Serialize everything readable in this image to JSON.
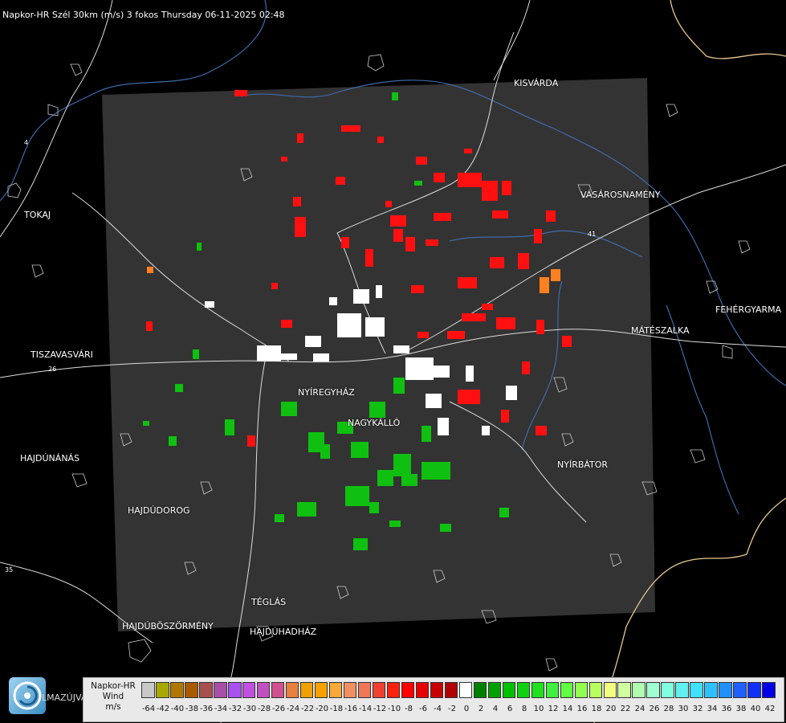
{
  "header": {
    "title": "Napkor-HR Szél 30km (m/s) 3 fokos Thursday 06-11-2025 02:48"
  },
  "cities": [
    {
      "id": "kisvarda",
      "label": "KISVÁRDA"
    },
    {
      "id": "vasarosnameny",
      "label": "VÁSÁROSNAMÉNY"
    },
    {
      "id": "tokaj",
      "label": "TOKAJ"
    },
    {
      "id": "fehergyarmat",
      "label": "FEHÉRGYARMA"
    },
    {
      "id": "mateszalka",
      "label": "MÁTÉSZALKA"
    },
    {
      "id": "tiszavasvari",
      "label": "TISZAVASVÁRI"
    },
    {
      "id": "nyiregyhaza",
      "label": "NYÍREGYHÁZ"
    },
    {
      "id": "nagykallo",
      "label": "NAGYKÁLLÓ"
    },
    {
      "id": "nyirbator",
      "label": "NYÍRBÁTOR"
    },
    {
      "id": "hajdunanas",
      "label": "HAJDÚNÁNÁS"
    },
    {
      "id": "hajdudorog",
      "label": "HAJDÚDOROG"
    },
    {
      "id": "teglas",
      "label": "TÉGLÁS"
    },
    {
      "id": "hajduboszormeny",
      "label": "HAJDÚBÖSZÖRMÉNY"
    },
    {
      "id": "hajduhadhaz",
      "label": "HAJDÚHADHÁZ"
    }
  ],
  "road_numbers": [
    "26",
    "35",
    "41",
    "4"
  ],
  "footer": {
    "logo_text": "LMAZÚJVÁR"
  },
  "legend": {
    "title_line1": "Napkor-HR",
    "title_line2": "Wind",
    "title_line3": "m/s",
    "ticks": [
      "-64",
      "-42",
      "-40",
      "-38",
      "-36",
      "-34",
      "-32",
      "-30",
      "-28",
      "-26",
      "-24",
      "-22",
      "-20",
      "-18",
      "-16",
      "-14",
      "-12",
      "-10",
      "-8",
      "-6",
      "-4",
      "-2",
      "0",
      "2",
      "4",
      "6",
      "8",
      "10",
      "12",
      "14",
      "16",
      "18",
      "20",
      "22",
      "24",
      "26",
      "28",
      "30",
      "32",
      "34",
      "36",
      "38",
      "40",
      "42"
    ],
    "colors": [
      "#c8c8c8",
      "#a8a800",
      "#b07800",
      "#a85a00",
      "#a85050",
      "#a850a8",
      "#a850f0",
      "#c050e0",
      "#c050c0",
      "#d05090",
      "#e88040",
      "#f0a000",
      "#f8a000",
      "#f8a838",
      "#f09060",
      "#f07858",
      "#f04030",
      "#ff2010",
      "#ff0000",
      "#e80000",
      "#c80000",
      "#b00000",
      "#ffffff",
      "#008000",
      "#00a000",
      "#00c000",
      "#10d010",
      "#20e020",
      "#40f040",
      "#60ff40",
      "#90ff50",
      "#b8ff60",
      "#f0ff80",
      "#d0ffa0",
      "#b0ffb0",
      "#a0ffd0",
      "#80ffe0",
      "#60f0f0",
      "#40e0ff",
      "#30c0ff",
      "#2090ff",
      "#2060ff",
      "#1030f8",
      "#0000e8"
    ]
  }
}
